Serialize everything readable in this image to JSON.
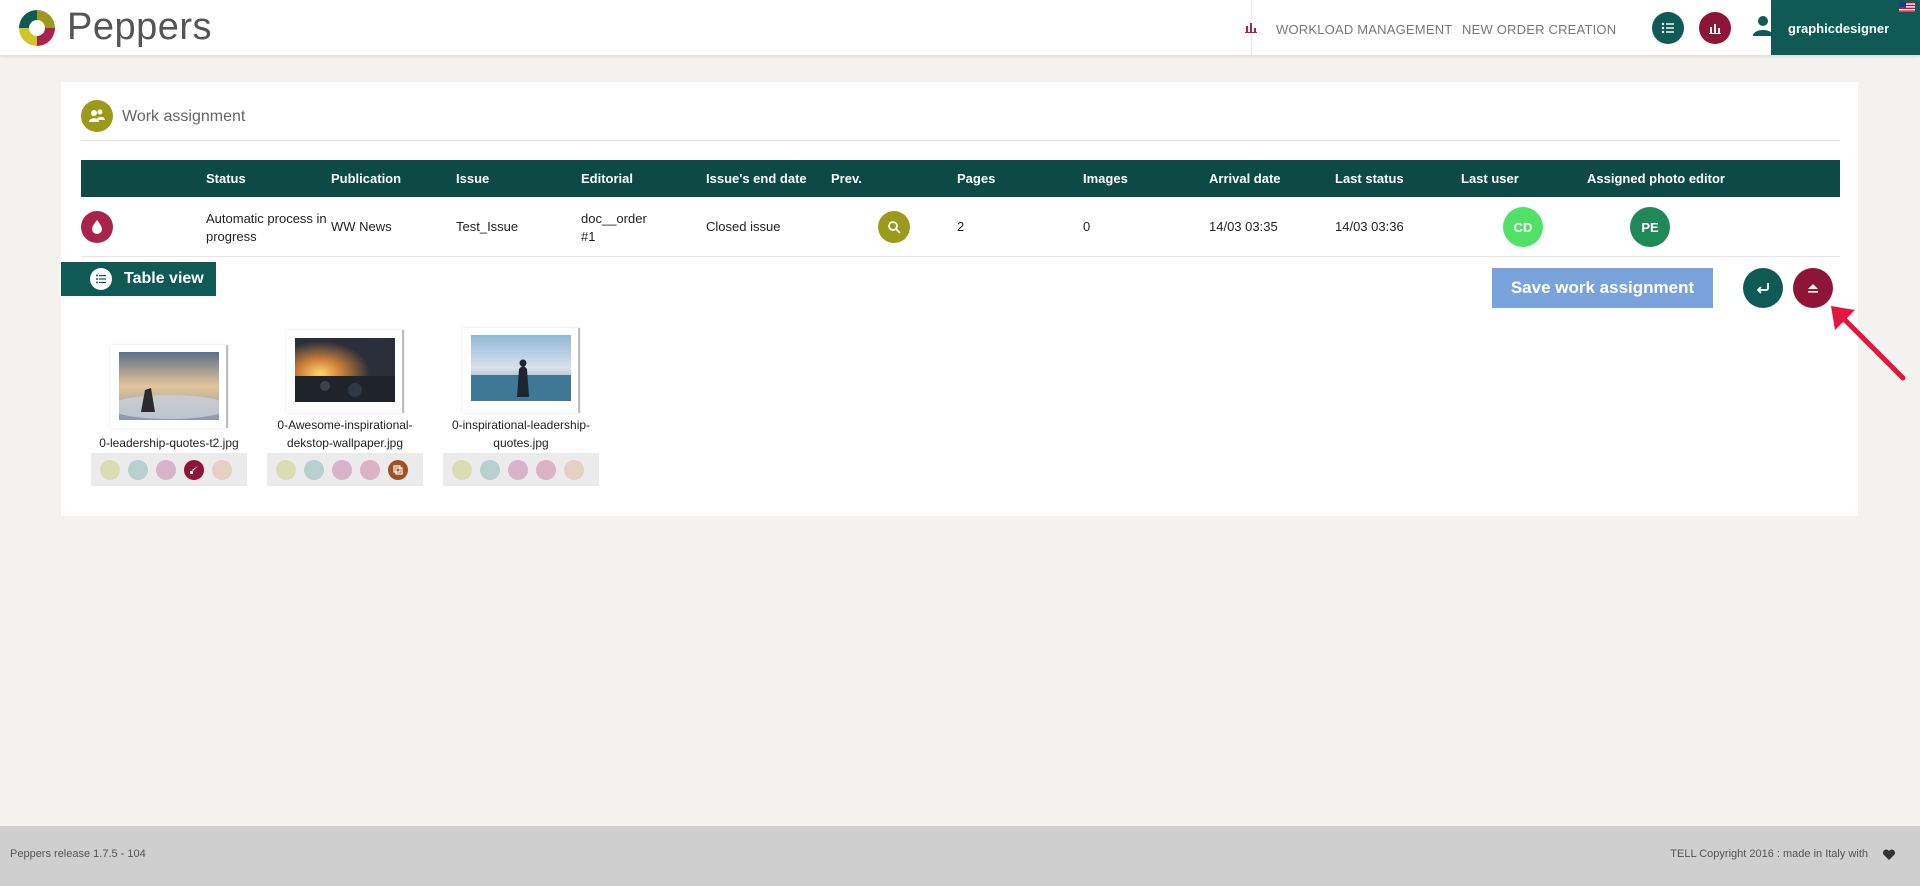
{
  "app": {
    "name": "Peppers"
  },
  "header": {
    "nav": [
      "WORKLOAD MANAGEMENT",
      "NEW ORDER CREATION"
    ],
    "user": "graphicdesigner"
  },
  "panel": {
    "title": "Work assignment"
  },
  "table": {
    "columns": [
      "Status",
      "Publication",
      "Issue",
      "Editorial",
      "Issue's end date",
      "Prev.",
      "Pages",
      "Images",
      "Arrival date",
      "Last status",
      "Last user",
      "Assigned photo editor"
    ],
    "row": {
      "status_line1": "Automatic process in",
      "status_line2": "progress",
      "publication": "WW News",
      "issue": "Test_Issue",
      "editorial_line1": "doc__order",
      "editorial_line2": "#1",
      "end_date": "Closed issue",
      "pages": "2",
      "images": "0",
      "arrival": "14/03 03:35",
      "last_status": "14/03 03:36",
      "last_user": "CD",
      "photo_editor": "PE"
    }
  },
  "toolbar": {
    "table_view": "Table view",
    "save": "Save work assignment"
  },
  "images": [
    {
      "name_line1": "0-leadership-quotes-t2.jpg",
      "name_line2": "",
      "active_tool": 3,
      "active_color": "#8e1538"
    },
    {
      "name_line1": "0-Awesome-inspirational-",
      "name_line2": "dekstop-wallpaper.jpg",
      "active_tool": 4,
      "active_color": "#a0521e"
    },
    {
      "name_line1": "0-inspirational-leadership-",
      "name_line2": "quotes.jpg",
      "active_tool": -1,
      "active_color": ""
    }
  ],
  "footer": {
    "release": "Peppers release 1.7.5 - 104",
    "copyright": "TELL Copyright 2016 : made in Italy with"
  },
  "colors": {
    "teal": "#0f5a55",
    "crimson": "#8e1538",
    "olive": "#9c9a1a",
    "save_blue": "#7aa3db"
  }
}
